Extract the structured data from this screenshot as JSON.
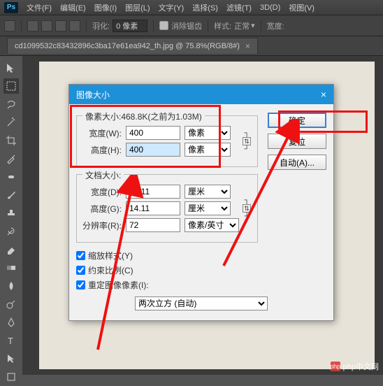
{
  "app": {
    "logo": "Ps"
  },
  "menu": {
    "items": [
      "文件(F)",
      "编辑(E)",
      "图像(I)",
      "图层(L)",
      "文字(Y)",
      "选择(S)",
      "滤镜(T)",
      "3D(D)",
      "视图(V)"
    ]
  },
  "optionbar": {
    "feather_label": "羽化:",
    "feather_value": "0 像素",
    "antialias_label": "消除锯齿",
    "style_label": "样式:",
    "style_value": "正常",
    "width_label": "宽度:"
  },
  "doc_tab": {
    "title": "cd1099532c83432896c3ba17e61ea942_th.jpg @ 75.8%(RGB/8#)",
    "close": "×"
  },
  "dialog": {
    "title": "图像大小",
    "close": "×",
    "pixel_group_title": "像素大小:468.8K(之前为1.03M)",
    "width_label": "宽度(W):",
    "height_label": "高度(H):",
    "width_value": "400",
    "height_value": "400",
    "unit_px": "像素",
    "doc_group_title": "文档大小:",
    "doc_width_label": "宽度(D):",
    "doc_height_label": "高度(G):",
    "doc_width_value": "14.11",
    "doc_height_value": "14.11",
    "unit_cm": "厘米",
    "res_label": "分辨率(R):",
    "res_value": "72",
    "res_unit": "像素/英寸",
    "scale_styles_label": "缩放样式(Y)",
    "constrain_label": "约束比例(C)",
    "resample_label": "重定图像像素(I):",
    "method": "两次立方 (自动)",
    "ok": "确定",
    "cancel": "复位",
    "auto": "自动(A)..."
  },
  "watermark": {
    "text": "php中文网"
  }
}
